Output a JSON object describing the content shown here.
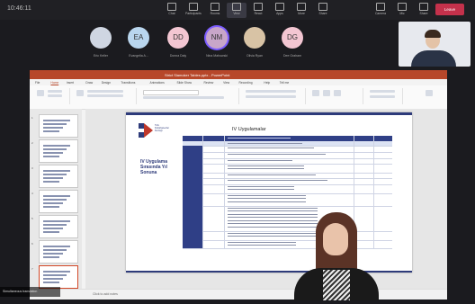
{
  "topbar": {
    "timer": "10:46:11",
    "buttons": [
      "Chat",
      "Participants",
      "Rooms",
      "View",
      "React",
      "Apps",
      "More",
      "Share",
      "Camera",
      "Mic",
      "Share"
    ],
    "leave_label": "Leave"
  },
  "participants": [
    {
      "initials": "",
      "label": "Eric Keller",
      "bg": "#cfd6e2"
    },
    {
      "initials": "EA",
      "label": "Evangelia A...",
      "bg": "#b9d6ee"
    },
    {
      "initials": "DD",
      "label": "Donna Daly",
      "bg": "#f3c6d2"
    },
    {
      "initials": "NM",
      "label": "Nina Mahowski",
      "bg": "#c8a6c9"
    },
    {
      "initials": "",
      "label": "Olivia Ryan",
      "bg": "#d8c3a5"
    },
    {
      "initials": "DG",
      "label": "Dee Graham",
      "bg": "#f3c6d2"
    }
  ],
  "ppt": {
    "window_title": "Strict Slamoker Tables.pptx - PowerPoint",
    "tabs": [
      "File",
      "Home",
      "Insert",
      "Draw",
      "Design",
      "Transitions",
      "Animations",
      "Slide Show",
      "Review",
      "View",
      "Recording",
      "Help",
      "Tell me"
    ],
    "selected_tab": "Home",
    "slide_numbers": [
      "1",
      "2",
      "3",
      "4",
      "5",
      "6",
      "7"
    ],
    "notes_hint": "Click to add notes"
  },
  "slide": {
    "title": "IV Uygulamalar",
    "left_text": "IV Uygulama Sırasında Yıl Sonuna",
    "logo_text": "Türk Kütüphaneciler Derneği"
  },
  "caption": "Simultaneous translation"
}
